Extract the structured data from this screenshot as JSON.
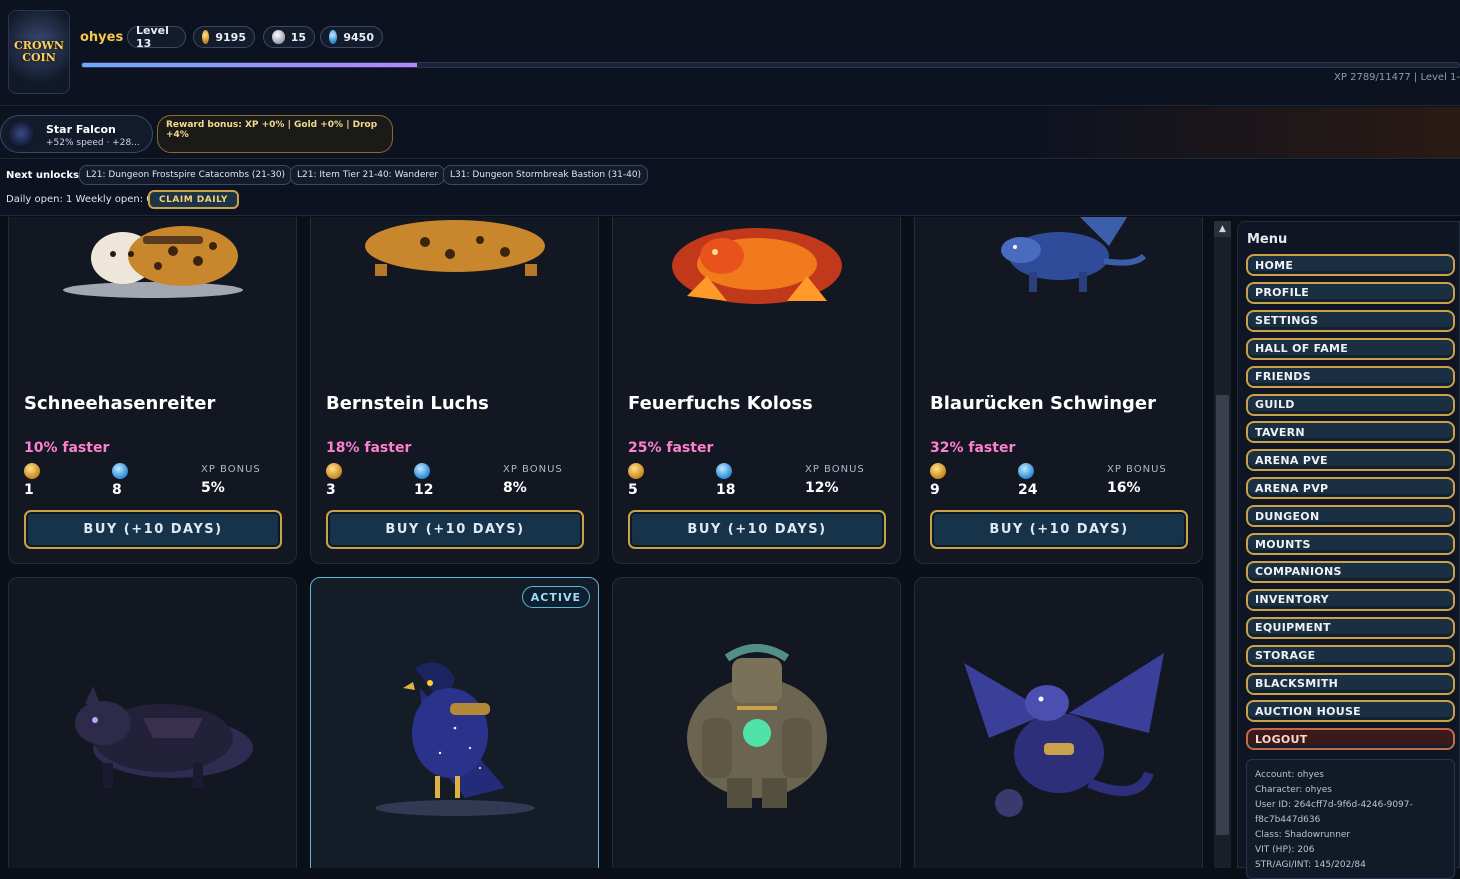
{
  "header": {
    "logo_text_line1": "CROWN",
    "logo_text_line2": "COIN",
    "player_name": "ohyes",
    "level_label": "Level 13",
    "gold": "9195",
    "silver": "15",
    "gems": "9450",
    "xp_fraction": 0.243,
    "xp_text": "XP 2789/11477 | Level 1-"
  },
  "mount_status": {
    "name": "Star Falcon",
    "stats": "+52% speed · +28...",
    "reward_text": "Reward bonus: XP +0% | Gold +0% | Drop +4%"
  },
  "unlocks": {
    "label": "Next unlocks:",
    "items": [
      "L21: Dungeon Frostspire Catacombs (21-30)",
      "L21: Item Tier 21-40: Wanderer",
      "L31: Dungeon Stormbreak Bastion (31-40)"
    ],
    "open_text": "Daily open: 1  Weekly open: 0",
    "claim_label": "CLAIM DAILY"
  },
  "mounts": [
    {
      "name": "Schneehasenreiter",
      "speed": "10% faster",
      "gold": "1",
      "gems": "8",
      "xp_label": "XP BONUS",
      "xp_bonus": "5%",
      "buy_label": "BUY (+10 DAYS)"
    },
    {
      "name": "Bernstein Luchs",
      "speed": "18% faster",
      "gold": "3",
      "gems": "12",
      "xp_label": "XP BONUS",
      "xp_bonus": "8%",
      "buy_label": "BUY (+10 DAYS)"
    },
    {
      "name": "Feuerfuchs Koloss",
      "speed": "25% faster",
      "gold": "5",
      "gems": "18",
      "xp_label": "XP BONUS",
      "xp_bonus": "12%",
      "buy_label": "BUY (+10 DAYS)"
    },
    {
      "name": "Blaurücken Schwinger",
      "speed": "32% faster",
      "gold": "9",
      "gems": "24",
      "xp_label": "XP BONUS",
      "xp_bonus": "16%",
      "buy_label": "BUY (+10 DAYS)"
    }
  ],
  "active_badge": "ACTIVE",
  "menu": {
    "title": "Menu",
    "items": [
      "HOME",
      "PROFILE",
      "SETTINGS",
      "HALL OF FAME",
      "FRIENDS",
      "GUILD",
      "TAVERN",
      "ARENA PVE",
      "ARENA PVP",
      "DUNGEON",
      "MOUNTS",
      "COMPANIONS",
      "INVENTORY",
      "EQUIPMENT",
      "STORAGE",
      "BLACKSMITH",
      "AUCTION HOUSE",
      "LOGOUT"
    ]
  },
  "account": {
    "account": "Account: ohyes",
    "character": "Character: ohyes",
    "user_id_1": "User ID: 264cff7d-9f6d-4246-9097-",
    "user_id_2": "f8c7b447d636",
    "class": "Class: Shadowrunner",
    "vit": "VIT (HP): 206",
    "str": "STR/AGI/INT: 145/202/84"
  },
  "colors": {
    "accent_gold": "#c9a24a",
    "speed_pink": "#ff7fd1",
    "active_cyan": "#5fb7d6"
  }
}
